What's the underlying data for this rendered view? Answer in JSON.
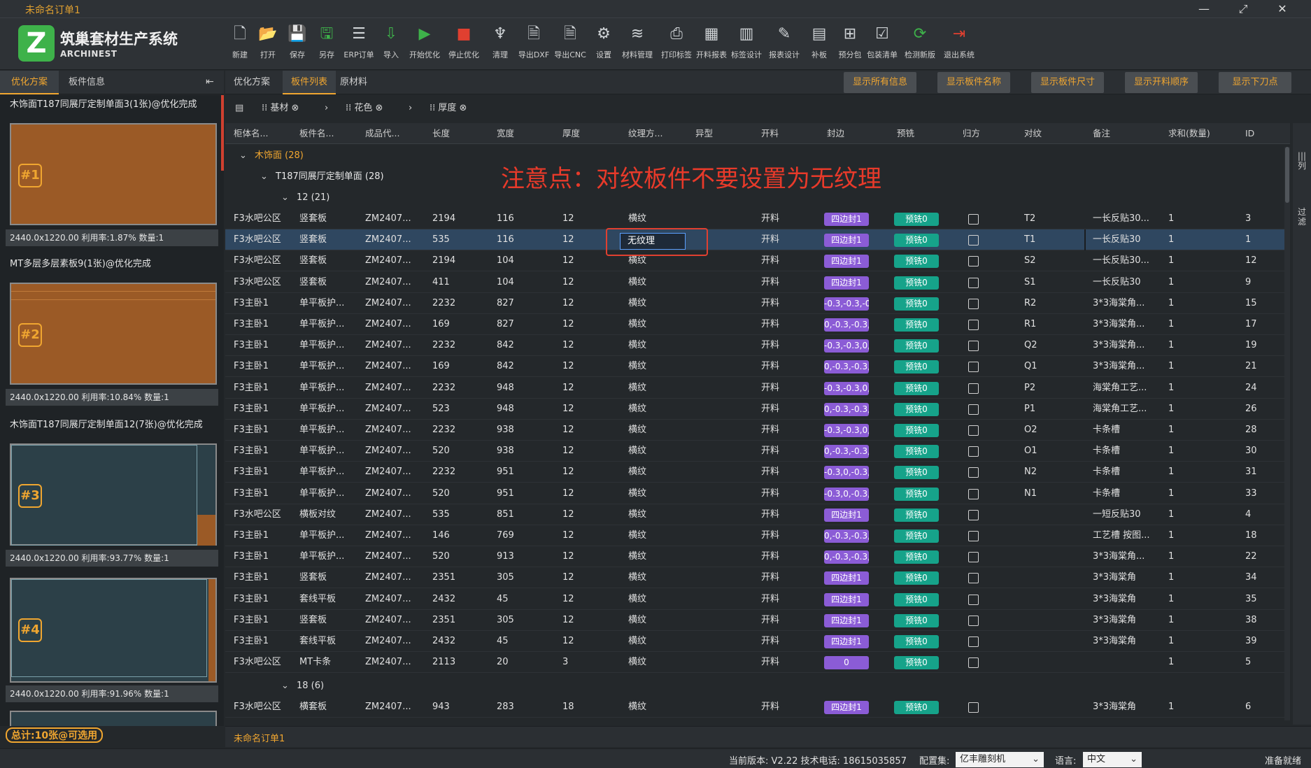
{
  "window": {
    "title": "未命名订单1"
  },
  "brand": {
    "name": "筑巢套材生产系统",
    "sub": "ARCHINEST",
    "logo_letter": "Z"
  },
  "toolbar": [
    {
      "label": "新建",
      "icon": "new-file-icon"
    },
    {
      "label": "打开",
      "icon": "open-folder-icon"
    },
    {
      "label": "保存",
      "icon": "save-icon"
    },
    {
      "label": "另存",
      "icon": "save-as-icon"
    },
    {
      "label": "ERP订单",
      "icon": "erp-order-icon"
    },
    {
      "label": "导入",
      "icon": "import-xml-icon"
    },
    {
      "label": "开始优化",
      "icon": "play-icon"
    },
    {
      "label": "停止优化",
      "icon": "stop-icon"
    },
    {
      "label": "清理",
      "icon": "broom-icon"
    },
    {
      "label": "导出DXF",
      "icon": "dxf-icon"
    },
    {
      "label": "导出CNC",
      "icon": "cnc-icon"
    },
    {
      "label": "设置",
      "icon": "gear-icon"
    },
    {
      "label": "材料管理",
      "icon": "layers-icon"
    },
    {
      "label": "打印标签",
      "icon": "printer-icon"
    },
    {
      "label": "开料报表",
      "icon": "report-icon"
    },
    {
      "label": "标签设计",
      "icon": "barcode-icon"
    },
    {
      "label": "报表设计",
      "icon": "report-design-icon"
    },
    {
      "label": "补板",
      "icon": "patch-board-icon"
    },
    {
      "label": "预分包",
      "icon": "package-tree-icon"
    },
    {
      "label": "包装清单",
      "icon": "packing-list-icon"
    },
    {
      "label": "检测新版",
      "icon": "update-icon"
    },
    {
      "label": "退出系统",
      "icon": "exit-icon"
    }
  ],
  "left_tabs": [
    "优化方案",
    "板件信息"
  ],
  "plans": [
    {
      "title": "木饰面T187同展厅定制单面3(1张)@优化完成",
      "badge": "#1",
      "caption": "2440.0x1220.00 利用率:1.87% 数量:1",
      "utilization": 0.0187,
      "fill": "#9b5a26"
    },
    {
      "title": "MT多层多层素板9(1张)@优化完成",
      "badge": "#2",
      "caption": "2440.0x1220.00 利用率:10.84% 数量:1",
      "utilization": 0.1084,
      "fill": "#9b5a26"
    },
    {
      "title": "木饰面T187同展厅定制单面12(7张)@优化完成",
      "badge": "#3",
      "caption": "2440.0x1220.00 利用率:93.77% 数量:1",
      "utilization": 0.9377,
      "fill": "#2c4048"
    },
    {
      "title": "",
      "badge": "#4",
      "caption": "2440.0x1220.00 利用率:91.96% 数量:1",
      "utilization": 0.9196,
      "fill": "#2c4048"
    }
  ],
  "total": "总计:10张@可选用",
  "main_tabs": [
    "优化方案",
    "板件列表",
    "原材料"
  ],
  "action_buttons": [
    "显示所有信息",
    "显示板件名称",
    "显示板件尺寸",
    "显示开料顺序",
    "显示下刀点"
  ],
  "filters": [
    "基材",
    "花色",
    "厚度"
  ],
  "columns": [
    "柜体名...",
    "板件名...",
    "成品代...",
    "长度",
    "宽度",
    "厚度",
    "纹理方...",
    "异型",
    "开料",
    "封边",
    "预铣",
    "归方",
    "对纹",
    "备注",
    "求和(数量)",
    "ID"
  ],
  "groups": {
    "g1": "木饰面 (28)",
    "g2": "T187同展厅定制单面 (28)",
    "g3": "12 (21)",
    "g4": "18 (6)"
  },
  "notice": "注意点：对纹板件不要设置为无纹理",
  "rows": [
    [
      "F3水吧公区",
      "竖套板",
      "ZM2407...",
      "2194",
      "116",
      "12",
      "横纹",
      "",
      "开料",
      "四边封1",
      "预铣0",
      "T2",
      "一长反贴30...",
      "1",
      "3"
    ],
    [
      "F3水吧公区",
      "竖套板",
      "ZM2407...",
      "535",
      "116",
      "12",
      "无纹理",
      "",
      "开料",
      "四边封1",
      "预铣0",
      "T1",
      "一长反贴30",
      "1",
      "1"
    ],
    [
      "F3水吧公区",
      "竖套板",
      "ZM2407...",
      "2194",
      "104",
      "12",
      "横纹",
      "",
      "开料",
      "四边封1",
      "预铣0",
      "S2",
      "一长反贴30...",
      "1",
      "12"
    ],
    [
      "F3水吧公区",
      "竖套板",
      "ZM2407...",
      "411",
      "104",
      "12",
      "横纹",
      "",
      "开料",
      "四边封1",
      "预铣0",
      "S1",
      "一长反贴30",
      "1",
      "9"
    ],
    [
      "F3主卧1",
      "单平板护...",
      "ZM2407...",
      "2232",
      "827",
      "12",
      "横纹",
      "",
      "开料",
      "-0.3,-0.3,-0",
      "预铣0",
      "R2",
      "3*3海棠角...",
      "1",
      "15"
    ],
    [
      "F3主卧1",
      "单平板护...",
      "ZM2407...",
      "169",
      "827",
      "12",
      "横纹",
      "",
      "开料",
      "0,-0.3,-0.3,",
      "预铣0",
      "R1",
      "3*3海棠角...",
      "1",
      "17"
    ],
    [
      "F3主卧1",
      "单平板护...",
      "ZM2407...",
      "2232",
      "842",
      "12",
      "横纹",
      "",
      "开料",
      "-0.3,-0.3,0,",
      "预铣0",
      "Q2",
      "3*3海棠角...",
      "1",
      "19"
    ],
    [
      "F3主卧1",
      "单平板护...",
      "ZM2407...",
      "169",
      "842",
      "12",
      "横纹",
      "",
      "开料",
      "0,-0.3,-0.3,",
      "预铣0",
      "Q1",
      "3*3海棠角...",
      "1",
      "21"
    ],
    [
      "F3主卧1",
      "单平板护...",
      "ZM2407...",
      "2232",
      "948",
      "12",
      "横纹",
      "",
      "开料",
      "-0.3,-0.3,0,",
      "预铣0",
      "P2",
      "海棠角工艺...",
      "1",
      "24"
    ],
    [
      "F3主卧1",
      "单平板护...",
      "ZM2407...",
      "523",
      "948",
      "12",
      "横纹",
      "",
      "开料",
      "0,-0.3,-0.3,",
      "预铣0",
      "P1",
      "海棠角工艺...",
      "1",
      "26"
    ],
    [
      "F3主卧1",
      "单平板护...",
      "ZM2407...",
      "2232",
      "938",
      "12",
      "横纹",
      "",
      "开料",
      "-0.3,-0.3,0,",
      "预铣0",
      "O2",
      "卡条槽",
      "1",
      "28"
    ],
    [
      "F3主卧1",
      "单平板护...",
      "ZM2407...",
      "520",
      "938",
      "12",
      "横纹",
      "",
      "开料",
      "0,-0.3,-0.3,",
      "预铣0",
      "O1",
      "卡条槽",
      "1",
      "30"
    ],
    [
      "F3主卧1",
      "单平板护...",
      "ZM2407...",
      "2232",
      "951",
      "12",
      "横纹",
      "",
      "开料",
      "-0.3,0,-0.3,",
      "预铣0",
      "N2",
      "卡条槽",
      "1",
      "31"
    ],
    [
      "F3主卧1",
      "单平板护...",
      "ZM2407...",
      "520",
      "951",
      "12",
      "横纹",
      "",
      "开料",
      "-0.3,0,-0.3,",
      "预铣0",
      "N1",
      "卡条槽",
      "1",
      "33"
    ],
    [
      "F3水吧公区",
      "横板对纹",
      "ZM2407...",
      "535",
      "851",
      "12",
      "横纹",
      "",
      "开料",
      "四边封1",
      "预铣0",
      "",
      "一短反贴30",
      "1",
      "4"
    ],
    [
      "F3主卧1",
      "单平板护...",
      "ZM2407...",
      "146",
      "769",
      "12",
      "横纹",
      "",
      "开料",
      "0,-0.3,-0.3,",
      "预铣0",
      "",
      "工艺槽 按图...",
      "1",
      "18"
    ],
    [
      "F3主卧1",
      "单平板护...",
      "ZM2407...",
      "520",
      "913",
      "12",
      "横纹",
      "",
      "开料",
      "0,-0.3,-0.3,",
      "预铣0",
      "",
      "3*3海棠角...",
      "1",
      "22"
    ],
    [
      "F3主卧1",
      "竖套板",
      "ZM2407...",
      "2351",
      "305",
      "12",
      "横纹",
      "",
      "开料",
      "四边封1",
      "预铣0",
      "",
      "3*3海棠角",
      "1",
      "34"
    ],
    [
      "F3主卧1",
      "套线平板",
      "ZM2407...",
      "2432",
      "45",
      "12",
      "横纹",
      "",
      "开料",
      "四边封1",
      "预铣0",
      "",
      "3*3海棠角",
      "1",
      "35"
    ],
    [
      "F3主卧1",
      "竖套板",
      "ZM2407...",
      "2351",
      "305",
      "12",
      "横纹",
      "",
      "开料",
      "四边封1",
      "预铣0",
      "",
      "3*3海棠角",
      "1",
      "38"
    ],
    [
      "F3主卧1",
      "套线平板",
      "ZM2407...",
      "2432",
      "45",
      "12",
      "横纹",
      "",
      "开料",
      "四边封1",
      "预铣0",
      "",
      "3*3海棠角",
      "1",
      "39"
    ],
    [
      "F3水吧公区",
      "MT卡条",
      "ZM2407...",
      "2113",
      "20",
      "3",
      "横纹",
      "",
      "开料",
      "0",
      "预铣0",
      "",
      "",
      "1",
      "5"
    ]
  ],
  "row_after": [
    "F3水吧公区",
    "横套板",
    "ZM2407...",
    "943",
    "283",
    "18",
    "横纹",
    "",
    "开料",
    "四边封1",
    "预铣0",
    "",
    "3*3海棠角",
    "1",
    "6"
  ],
  "right_strip": [
    "列",
    "过滤"
  ],
  "bottom_tab": "未命名订单1",
  "status": {
    "version_text": "当前版本: V2.22 技术电话: 18615035857",
    "config_label": "配置集:",
    "config_value": "亿丰雕刻机",
    "lang_label": "语言:",
    "lang_value": "中文",
    "ready": "准备就绪"
  }
}
